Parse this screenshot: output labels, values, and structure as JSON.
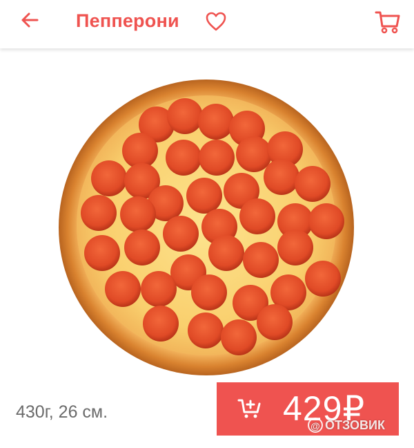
{
  "header": {
    "title": "Пепперони",
    "back_icon": "arrow-left-icon",
    "favorite_icon": "heart-outline-icon",
    "cart_icon": "cart-icon"
  },
  "product": {
    "image_icon": "pizza-pepperoni-image",
    "weight_size": "430г, 26 см.",
    "price": "429₽",
    "buy_icon": "cart-add-icon"
  },
  "watermark": {
    "text": "ОТЗОВИК"
  },
  "colors": {
    "accent": "#ef5350",
    "muted_text": "#6b6b6b",
    "background": "#ffffff"
  }
}
